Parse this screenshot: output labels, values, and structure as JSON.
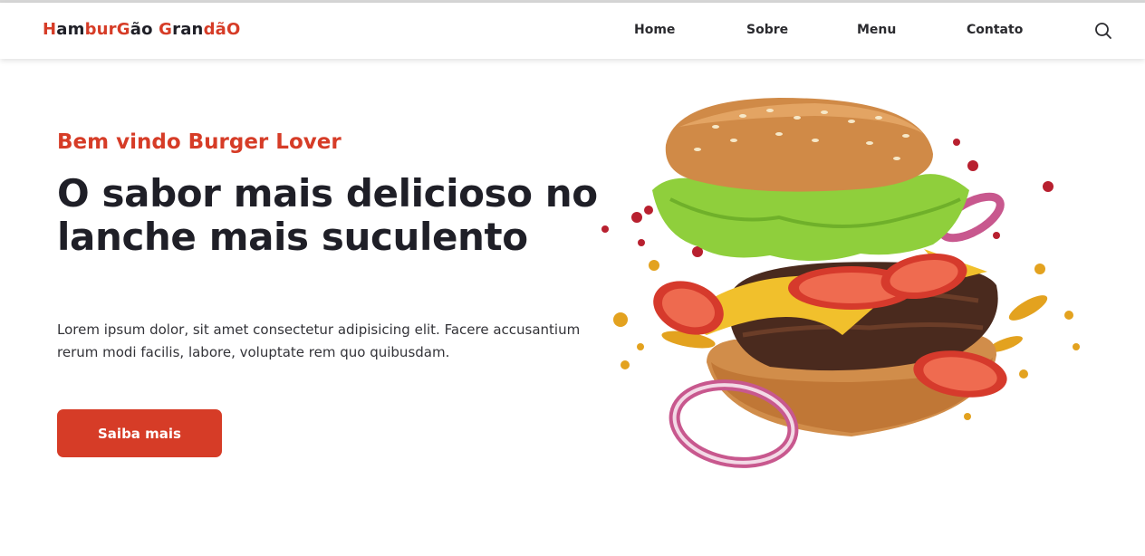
{
  "colors": {
    "accent": "#d63c27",
    "text_dark": "#1f1f27",
    "nav_text": "#2a2a2e"
  },
  "header": {
    "logo": {
      "text": "HamburGão GrandãO",
      "letters": [
        {
          "ch": "H",
          "accent": true
        },
        {
          "ch": "am",
          "accent": false
        },
        {
          "ch": "bur",
          "accent": true
        },
        {
          "ch": "G",
          "accent": true
        },
        {
          "ch": "ão",
          "accent": false
        },
        {
          "ch": " ",
          "accent": false
        },
        {
          "ch": "G",
          "accent": true
        },
        {
          "ch": "ran",
          "accent": false
        },
        {
          "ch": "dãO",
          "accent": true
        }
      ]
    },
    "nav": [
      {
        "label": "Home"
      },
      {
        "label": "Sobre"
      },
      {
        "label": "Menu"
      },
      {
        "label": "Contato"
      }
    ],
    "search_icon": "search-icon"
  },
  "hero": {
    "subtitle": "Bem vindo Burger Lover",
    "title": "O sabor mais delicioso no lanche mais suculento",
    "text": "Lorem ipsum dolor, sit amet consectetur adipisicing elit. Facere accusantium rerum modi facilis, labore, voluptate rem quo quibusdam.",
    "cta_label": "Saiba mais",
    "image_subject": "flying-burger-image"
  }
}
